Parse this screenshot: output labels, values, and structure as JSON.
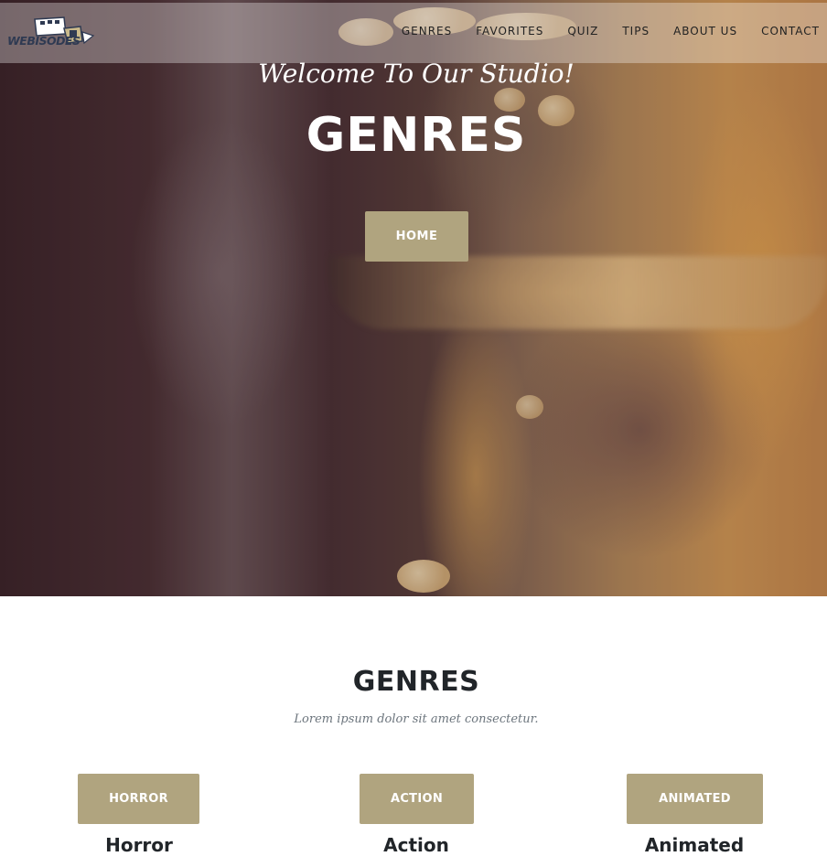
{
  "brand": {
    "logo_text": "WEBISODES"
  },
  "nav": {
    "items": [
      {
        "label": "GENRES"
      },
      {
        "label": "FAVORITES"
      },
      {
        "label": "QUIZ"
      },
      {
        "label": "TIPS"
      },
      {
        "label": "ABOUT US"
      },
      {
        "label": "CONTACT"
      }
    ]
  },
  "hero": {
    "subtitle": "Welcome To Our Studio!",
    "title": "GENRES",
    "button_label": "HOME"
  },
  "section": {
    "title": "GENRES",
    "subtitle": "Lorem ipsum dolor sit amet consectetur.",
    "genres": [
      {
        "button_label": "HORROR",
        "name": "Horror"
      },
      {
        "button_label": "ACTION",
        "name": "Action"
      },
      {
        "button_label": "ANIMATED",
        "name": "Animated"
      }
    ]
  },
  "colors": {
    "accent": "#b0a47f",
    "heading": "#212529",
    "muted": "#6c757d"
  },
  "icons": {
    "logo": "film-camera-logo-icon"
  }
}
